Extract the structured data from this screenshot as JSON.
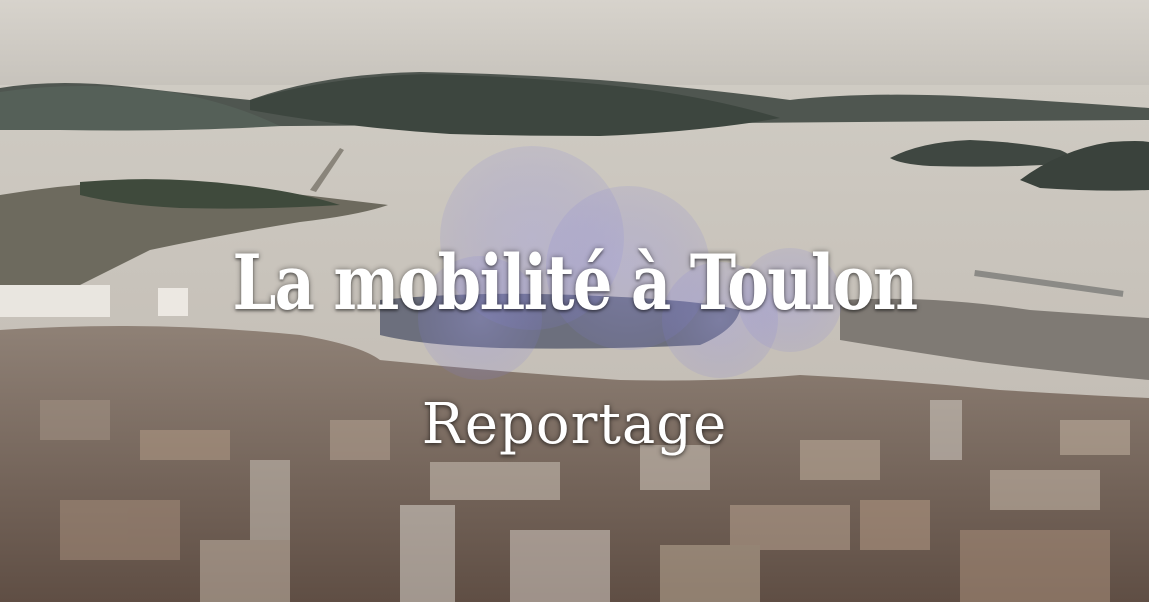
{
  "video": {
    "title": "La mobilité à Toulon",
    "subtitle": "Reportage"
  }
}
